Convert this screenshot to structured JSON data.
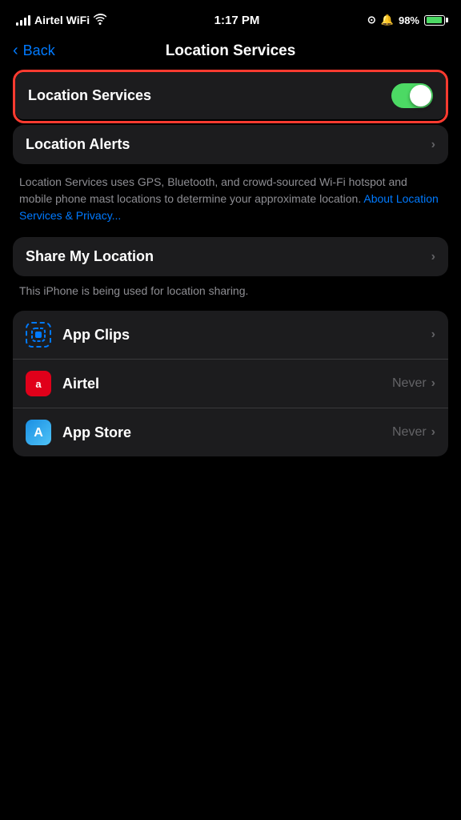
{
  "statusBar": {
    "carrier": "Airtel WiFi",
    "time": "1:17 PM",
    "batteryPercent": "98%"
  },
  "navBar": {
    "backLabel": "Back",
    "title": "Location Services"
  },
  "locationServicesToggle": {
    "label": "Location Services",
    "enabled": true
  },
  "locationAlerts": {
    "label": "Location Alerts"
  },
  "description": {
    "text": "Location Services uses GPS, Bluetooth, and crowd-sourced Wi-Fi hotspot and mobile phone mast locations to determine your approximate location. ",
    "linkText": "About Location Services & Privacy..."
  },
  "shareMyLocation": {
    "label": "Share My Location",
    "description": "This iPhone is being used for location sharing."
  },
  "apps": [
    {
      "name": "App Clips",
      "iconType": "app-clips",
      "permission": ""
    },
    {
      "name": "Airtel",
      "iconType": "airtel",
      "permission": "Never"
    },
    {
      "name": "App Store",
      "iconType": "appstore",
      "permission": "Never"
    }
  ],
  "icons": {
    "chevronRight": "›",
    "chevronLeft": "‹"
  }
}
